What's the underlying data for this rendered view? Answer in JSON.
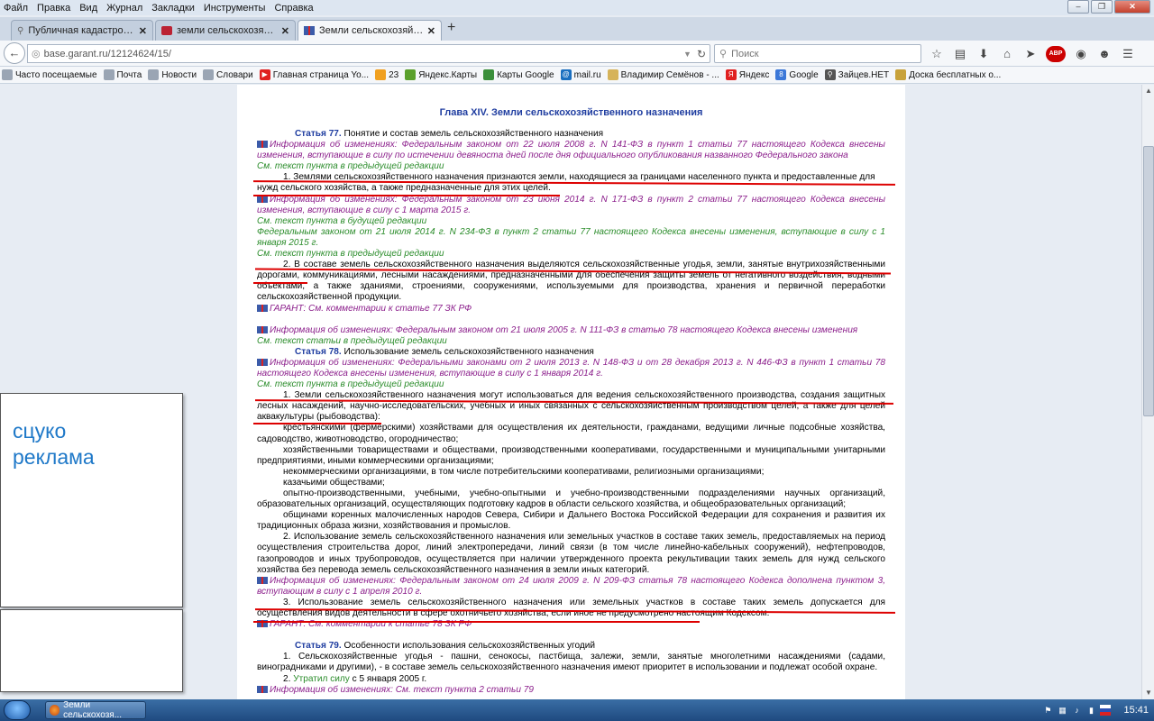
{
  "menubar": {
    "items": [
      "Файл",
      "Правка",
      "Вид",
      "Журнал",
      "Закладки",
      "Инструменты",
      "Справка"
    ]
  },
  "tabs": [
    {
      "label": "Публичная кадастровая ка...",
      "icon": "puzzle-icon"
    },
    {
      "label": "земли сельскохозяйственно...",
      "icon": "garant-icon"
    },
    {
      "label": "Земли сельскохозяйственно...",
      "icon": "garant-icon",
      "active": true
    }
  ],
  "navbar": {
    "url": "base.garant.ru/12124624/15/",
    "search_placeholder": "Поиск"
  },
  "bookmarks": [
    {
      "label": "Часто посещаемые",
      "color": "#9aa5b4"
    },
    {
      "label": "Почта",
      "color": "#9aa5b4"
    },
    {
      "label": "Новости",
      "color": "#9aa5b4"
    },
    {
      "label": "Словари",
      "color": "#9aa5b4"
    },
    {
      "label": "Главная страница Yo...",
      "color": "#e02020"
    },
    {
      "label": "23",
      "color": "#f0a020"
    },
    {
      "label": "Яндекс.Карты",
      "color": "#5aa02c"
    },
    {
      "label": "Карты Google",
      "color": "#3b8f3b"
    },
    {
      "label": "mail.ru",
      "color": "#1a6fc0"
    },
    {
      "label": "Владимир Семёнов - ...",
      "color": "#d6b35a"
    },
    {
      "label": "Яндекс",
      "color": "#e02020"
    },
    {
      "label": "Google",
      "color": "#3c78d8"
    },
    {
      "label": "Зайцев.НЕТ",
      "color": "#555555"
    },
    {
      "label": "Доска бесплатных о...",
      "color": "#c8a23a"
    }
  ],
  "document": {
    "chapter": "Глава XIV. Земли сельскохозяйственного назначения",
    "art77_title": "Статья 77.",
    "art77_name": " Понятие и состав земель сельскохозяйственного назначения",
    "info1": "Информация об изменениях: Федеральным законом от 22 июля 2008 г. N 141-ФЗ в пункт 1 статьи 77 настоящего Кодекса внесены изменения, вступающие в силу по истечении девяноста дней после дня официального опубликования названного Федерального закона",
    "see1": "См. текст пункта в предыдущей редакции",
    "p77_1a": "1. Землями сельскохозяйственного назначения признаются земли, находящиеся за границами населенного пункта и предоставленные для",
    "p77_1b": "нужд сельского хозяйства, а также предназначенные для этих целей.",
    "info2": "Информация об изменениях: Федеральным законом от 23 июня 2014 г. N 171-ФЗ в пункт 2 статьи 77 настоящего Кодекса внесены изменения, вступающие в силу с 1 марта 2015 г.",
    "see2": "См. текст пункта в будущей редакции",
    "info3": "Федеральным законом от 21 июля 2014 г. N 234-ФЗ в пункт 2 статьи 77 настоящего Кодекса внесены изменения, вступающие в силу с 1 января 2015 г.",
    "see3": "См. текст пункта в предыдущей редакции",
    "p77_2a": "2. В составе земель сельскохозяйственного назначения выделяются сельскохозяйственные угодья, земли, занятые внутрихозяйственными",
    "p77_2b": "дорогами, коммуникациями, лесными насаждениями, предназначенными для обеспечения защиты земель от негативного воздействия, водными объектами, а также зданиями, строениями, сооружениями, используемыми для производства, хранения и первичной переработки сельскохозяйственной продукции.",
    "garant77": "ГАРАНТ: См. комментарии к статье 77 ЗК РФ",
    "info4": "Информация об изменениях: Федеральным законом от 21 июля 2005 г. N 111-ФЗ в статью 78 настоящего Кодекса внесены изменения",
    "see4": "См. текст статьи в предыдущей редакции",
    "art78_title": "Статья 78.",
    "art78_name": " Использование земель сельскохозяйственного назначения",
    "info5": "Информация об изменениях: Федеральными законами от 2 июля 2013 г. N 148-ФЗ и от 28 декабря 2013 г. N 446-ФЗ в пункт 1 статьи 78 настоящего Кодекса внесены изменения, вступающие в силу с 1 января 2014 г.",
    "see5": "См. текст пункта в предыдущей редакции",
    "p78_1a": "1. Земли сельскохозяйственного назначения могут использоваться для ведения сельскохозяйственного производства, создания защитных",
    "p78_1b": "лесных насаждений, научно-исследовательских, учебных и иных связанных с сельскохозяйственным производством целей, а также для целей аквакультуры (рыбоводства):",
    "l1": "крестьянскими (фермерскими) хозяйствами для осуществления их деятельности, гражданами, ведущими личные подсобные хозяйства, садоводство, животноводство, огородничество;",
    "l2": "хозяйственными товариществами и обществами, производственными кооперативами, государственными и муниципальными унитарными предприятиями, иными коммерческими организациями;",
    "l3": "некоммерческими организациями, в том числе потребительскими кооперативами, религиозными организациями;",
    "l4": "казачьими обществами;",
    "l5": "опытно-производственными, учебными, учебно-опытными и учебно-производственными подразделениями научных организаций, образовательных организаций, осуществляющих подготовку кадров в области сельского хозяйства, и общеобразовательных организаций;",
    "l6": "общинами коренных малочисленных народов Севера, Сибири и Дальнего Востока Российской Федерации для сохранения и развития их традиционных образа жизни, хозяйствования и промыслов.",
    "p78_2": "2. Использование земель сельскохозяйственного назначения или земельных участков в составе таких земель, предоставляемых на период осуществления строительства дорог, линий электропередачи, линий связи (в том числе линейно-кабельных сооружений), нефтепроводов, газопроводов и иных трубопроводов, осуществляется при наличии утвержденного проекта рекультивации таких земель для нужд сельского хозяйства без перевода земель сельскохозяйственного назначения в земли иных категорий.",
    "info6": "Информация об изменениях: Федеральным законом от 24 июля 2009 г. N 209-ФЗ статья 78 настоящего Кодекса дополнена пунктом 3, вступающим в силу с 1 апреля 2010 г.",
    "p78_3a": "3. Использование земель сельскохозяйственного назначения или земельных участков в составе таких земель допускается для осуществления",
    "p78_3b": "видов деятельности в сфере охотничьего хозяйства, если иное не предусмотрено настоящим Кодексом.",
    "garant78": "ГАРАНТ: См. комментарии к статье 78 ЗК РФ",
    "art79_title": "Статья 79.",
    "art79_name": " Особенности использования сельскохозяйственных угодий",
    "p79_1": "1. Сельскохозяйственные угодья - пашни, сенокосы, пастбища, залежи, земли, занятые многолетними насаждениями (садами, виноградниками и другими), - в составе земель сельскохозяйственного назначения имеют приоритет в использовании и подлежат особой охране.",
    "p79_2a": "2. ",
    "p79_2b": "Утратил силу",
    "p79_2c": " с 5 января 2005 г.",
    "info7": "Информация об изменениях: См. текст пункта 2 статьи 79"
  },
  "ad": {
    "line1": "сцуко",
    "line2": "реклама"
  },
  "taskbar": {
    "task_label": "Земли сельскохозя...",
    "clock": "15:41"
  }
}
